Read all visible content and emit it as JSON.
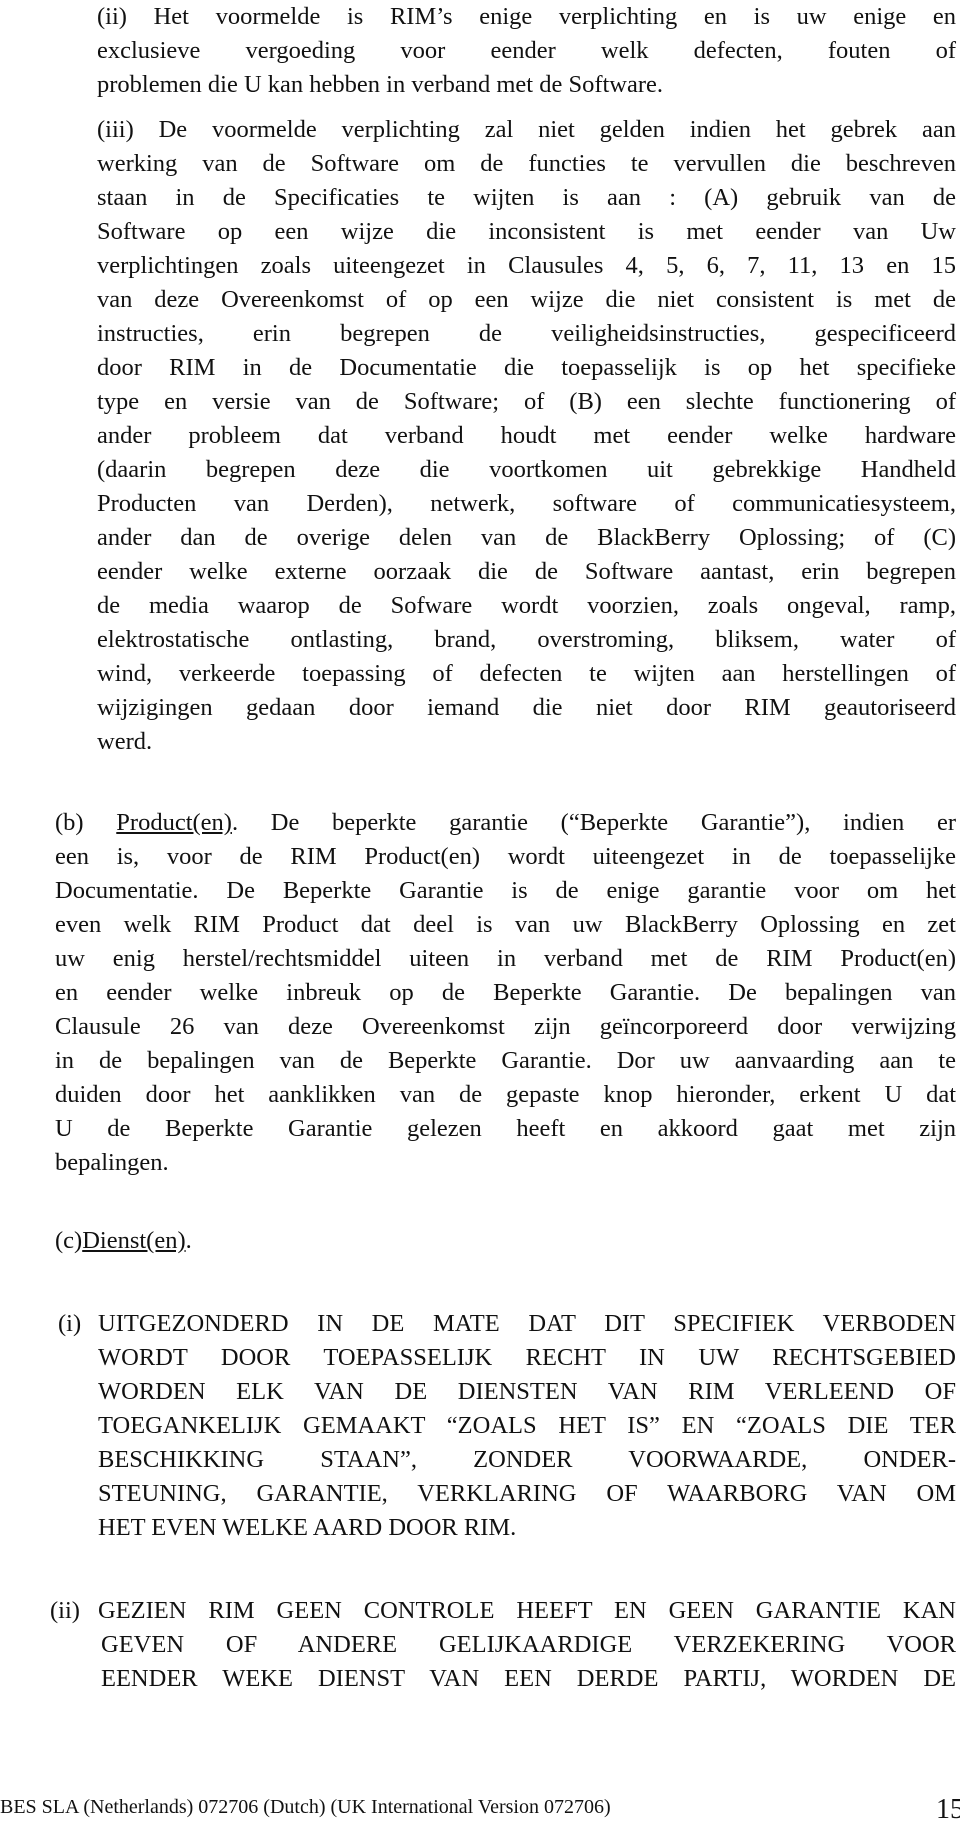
{
  "document": {
    "section_a_ii": {
      "label": "(ii)",
      "lines": [
        "Het voormelde is RIM’s enige verplichting en is uw enige en",
        "exclusieve vergoeding voor eender welk defecten, fouten of",
        "problemen die U kan hebben in verband met de Software."
      ]
    },
    "section_a_iii": {
      "label": "(iii)",
      "lines": [
        "De voormelde verplichting zal niet gelden indien het gebrek aan",
        "werking van de Software om de functies te vervullen die beschreven",
        "staan in de Specificaties te wijten is aan : (A) gebruik van de",
        "Software op een wijze die inconsistent is met eender van Uw",
        "verplichtingen zoals uiteengezet in Clausules 4, 5, 6, 7, 11, 13 en 15",
        "van deze Overeenkomst of op een wijze die niet consistent is met de",
        "instructies, erin begrepen de veiligheidsinstructies, gespecificeerd",
        "door RIM in de Documentatie die toepasselijk is op het specifieke",
        "type en versie van de Software; of (B) een slechte functionering of",
        "ander probleem dat verband houdt met eender welke hardware",
        "(daarin begrepen deze die voortkomen uit gebrekkige Handheld",
        "Producten van Derden), netwerk, software of communicatiesysteem,",
        "ander dan de overige delen van de BlackBerry Oplossing; of (C)",
        "eender welke externe oorzaak die de Software aantast, erin begrepen",
        "de media waarop de Sofware wordt voorzien, zoals ongeval, ramp,",
        "elektrostatische ontlasting, brand, overstroming, bliksem, water of",
        "wind, verkeerde toepassing of defecten te wijten aan herstellingen of",
        "wijzigingen gedaan door iemand die niet door RIM geautoriseerd",
        "werd."
      ]
    },
    "section_b": {
      "label": "(b)",
      "heading": "Product(en)",
      "first_line_rest": ". De beperkte garantie (“Beperkte Garantie”), indien er",
      "lines": [
        "een is, voor de RIM Product(en) wordt uiteengezet in de toepasselijke",
        "Documentatie. De Beperkte Garantie is de enige garantie voor om het",
        "even welk RIM Product dat deel is van uw BlackBerry Oplossing en zet",
        "uw enig herstel/rechtsmiddel uiteen in verband met de RIM Product(en)",
        "en eender welke inbreuk op de Beperkte Garantie. De bepalingen van",
        "Clausule 26 van deze Overeenkomst zijn geïncorporeerd door verwijzing",
        "in de bepalingen van de Beperkte Garantie. Dor uw aanvaarding aan te",
        "duiden door het aanklikken van de gepaste knop hieronder, erkent U dat",
        "U de Beperkte Garantie gelezen heeft en akkoord gaat met zijn",
        "bepalingen."
      ]
    },
    "section_c": {
      "label": "(c)",
      "heading": "Dienst(en)",
      "heading_suffix": ".",
      "items": [
        {
          "label": "(i)",
          "lines": [
            "UITGEZONDERD IN DE MATE DAT DIT SPECIFIEK VERBODEN",
            "WORDT DOOR TOEPASSELIJK RECHT IN UW RECHTSGEBIED",
            "WORDEN ELK VAN DE DIENSTEN VAN RIM  VERLEEND OF",
            "TOEGANKELIJK GEMAAKT “ZOALS HET IS” EN “ZOALS DIE TER",
            "BESCHIKKING STAAN”, ZONDER VOORWAARDE, ONDER-",
            "STEUNING, GARANTIE, VERKLARING OF WAARBORG VAN OM",
            "HET EVEN WELKE AARD DOOR RIM."
          ]
        },
        {
          "label": "(ii)",
          "lines": [
            "GEZIEN RIM GEEN CONTROLE HEEFT EN GEEN GARANTIE KAN",
            "GEVEN OF ANDERE GELIJKAARDIGE VERZEKERING VOOR",
            "EENDER WEKE DIENST VAN EEN DERDE PARTIJ, WORDEN DE"
          ]
        }
      ]
    },
    "footer": {
      "text": "BES SLA (Netherlands) 072706 (Dutch) (UK International Version 072706)",
      "page_number": "15"
    }
  }
}
